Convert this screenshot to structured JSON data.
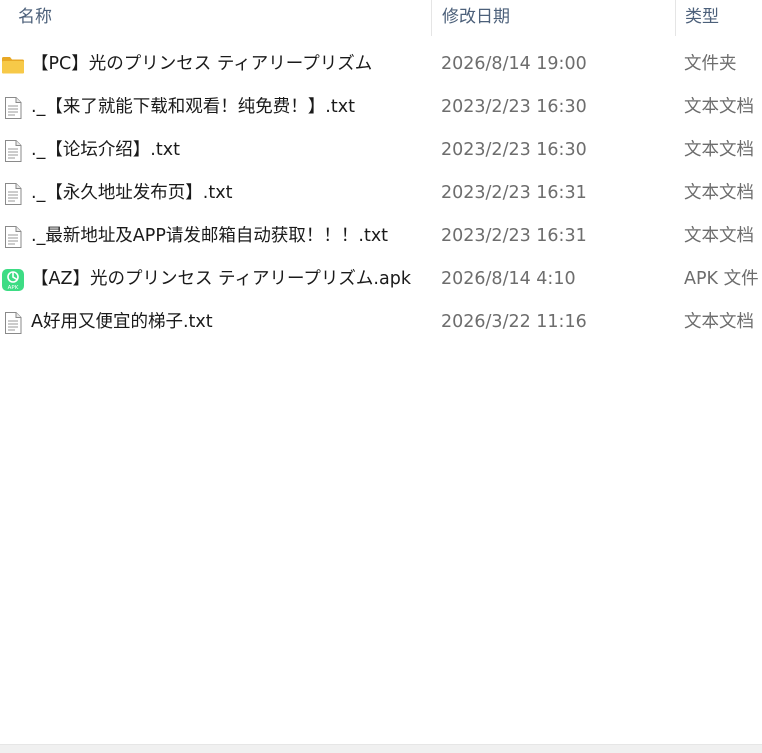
{
  "header": {
    "name_label": "名称",
    "date_label": "修改日期",
    "type_label": "类型",
    "sort_indicator": "^"
  },
  "files": [
    {
      "name": "【PC】光のプリンセス ティアリープリズム",
      "date": "2026/8/14 19:00",
      "type": "文件夹",
      "icon": "folder-icon"
    },
    {
      "name": "._【来了就能下载和观看！纯免费！】.txt",
      "date": "2023/2/23 16:30",
      "type": "文本文档",
      "icon": "text-file-icon"
    },
    {
      "name": "._【论坛介绍】.txt",
      "date": "2023/2/23 16:30",
      "type": "文本文档",
      "icon": "text-file-icon"
    },
    {
      "name": "._【永久地址发布页】.txt",
      "date": "2023/2/23 16:31",
      "type": "文本文档",
      "icon": "text-file-icon"
    },
    {
      "name": "._最新地址及APP请发邮箱自动获取！！！.txt",
      "date": "2023/2/23 16:31",
      "type": "文本文档",
      "icon": "text-file-icon"
    },
    {
      "name": "【AZ】光のプリンセス ティアリープリズム.apk",
      "date": "2026/8/14 4:10",
      "type": "APK 文件",
      "icon": "apk-file-icon",
      "icon_text": "APK"
    },
    {
      "name": "A好用又便宜的梯子.txt",
      "date": "2026/3/22 11:16",
      "type": "文本文档",
      "icon": "text-file-icon"
    }
  ],
  "colors": {
    "header_text": "#4c607a",
    "date_type_text": "#6d6d6d",
    "folder_yellow": "#f7c948",
    "apk_green": "#3ddc84"
  }
}
